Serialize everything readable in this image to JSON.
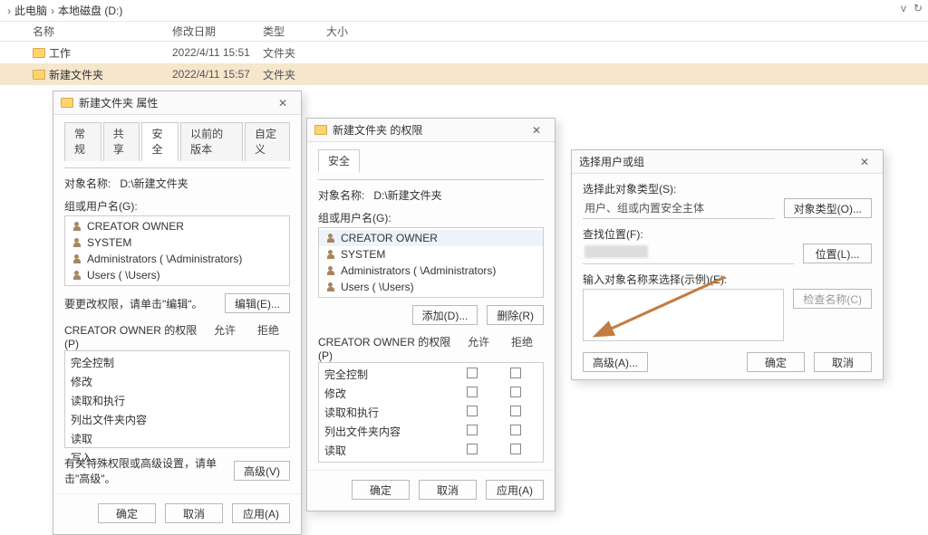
{
  "breadcrumb": {
    "a": "此电脑",
    "b": "本地磁盘 (D:)"
  },
  "top_right": {
    "down": "v",
    "up": "ꜛ"
  },
  "columns": {
    "name": "名称",
    "date": "修改日期",
    "type": "类型",
    "size": "大小"
  },
  "rows": [
    {
      "name": "工作",
      "date": "2022/4/11 15:51",
      "type": "文件夹"
    },
    {
      "name": "新建文件夹",
      "date": "2022/4/11 15:57",
      "type": "文件夹"
    }
  ],
  "dlg1": {
    "title": "新建文件夹 属性",
    "tabs": {
      "general": "常规",
      "share": "共享",
      "security": "安全",
      "prev": "以前的版本",
      "custom": "自定义"
    },
    "object_label": "对象名称:",
    "object_value": "D:\\新建文件夹",
    "group_label": "组或用户名(G):",
    "users": [
      "CREATOR OWNER",
      "SYSTEM",
      "Administrators (                        \\Administrators)",
      "Users (                        \\Users)"
    ],
    "edit_hint": "要更改权限，请单击\"编辑\"。",
    "edit_btn": "编辑(E)...",
    "perm_header": "CREATOR OWNER 的权限(P)",
    "allow": "允许",
    "deny": "拒绝",
    "perms": [
      "完全控制",
      "修改",
      "读取和执行",
      "列出文件夹内容",
      "读取",
      "写入"
    ],
    "adv_hint": "有关特殊权限或高级设置，请单击\"高级\"。",
    "adv_btn": "高级(V)",
    "ok": "确定",
    "cancel": "取消",
    "apply": "应用(A)"
  },
  "dlg2": {
    "title": "新建文件夹 的权限",
    "tab_security": "安全",
    "object_label": "对象名称:",
    "object_value": "D:\\新建文件夹",
    "group_label": "组或用户名(G):",
    "users": [
      "CREATOR OWNER",
      "SYSTEM",
      "Administrators (                        \\Administrators)",
      "Users (                        \\Users)"
    ],
    "add_btn": "添加(D)...",
    "remove_btn": "删除(R)",
    "perm_header": "CREATOR OWNER 的权限(P)",
    "allow": "允许",
    "deny": "拒绝",
    "perms": [
      "完全控制",
      "修改",
      "读取和执行",
      "列出文件夹内容",
      "读取"
    ],
    "ok": "确定",
    "cancel": "取消",
    "apply": "应用(A)"
  },
  "dlg3": {
    "title": "选择用户或组",
    "type_label": "选择此对象类型(S):",
    "type_value": "用户、组或内置安全主体",
    "type_btn": "对象类型(O)...",
    "loc_label": "查找位置(F):",
    "loc_btn": "位置(L)...",
    "name_label": "输入对象名称来选择(示例)(E):",
    "check_btn": "检查名称(C)",
    "adv_btn": "高级(A)...",
    "ok": "确定",
    "cancel": "取消"
  }
}
